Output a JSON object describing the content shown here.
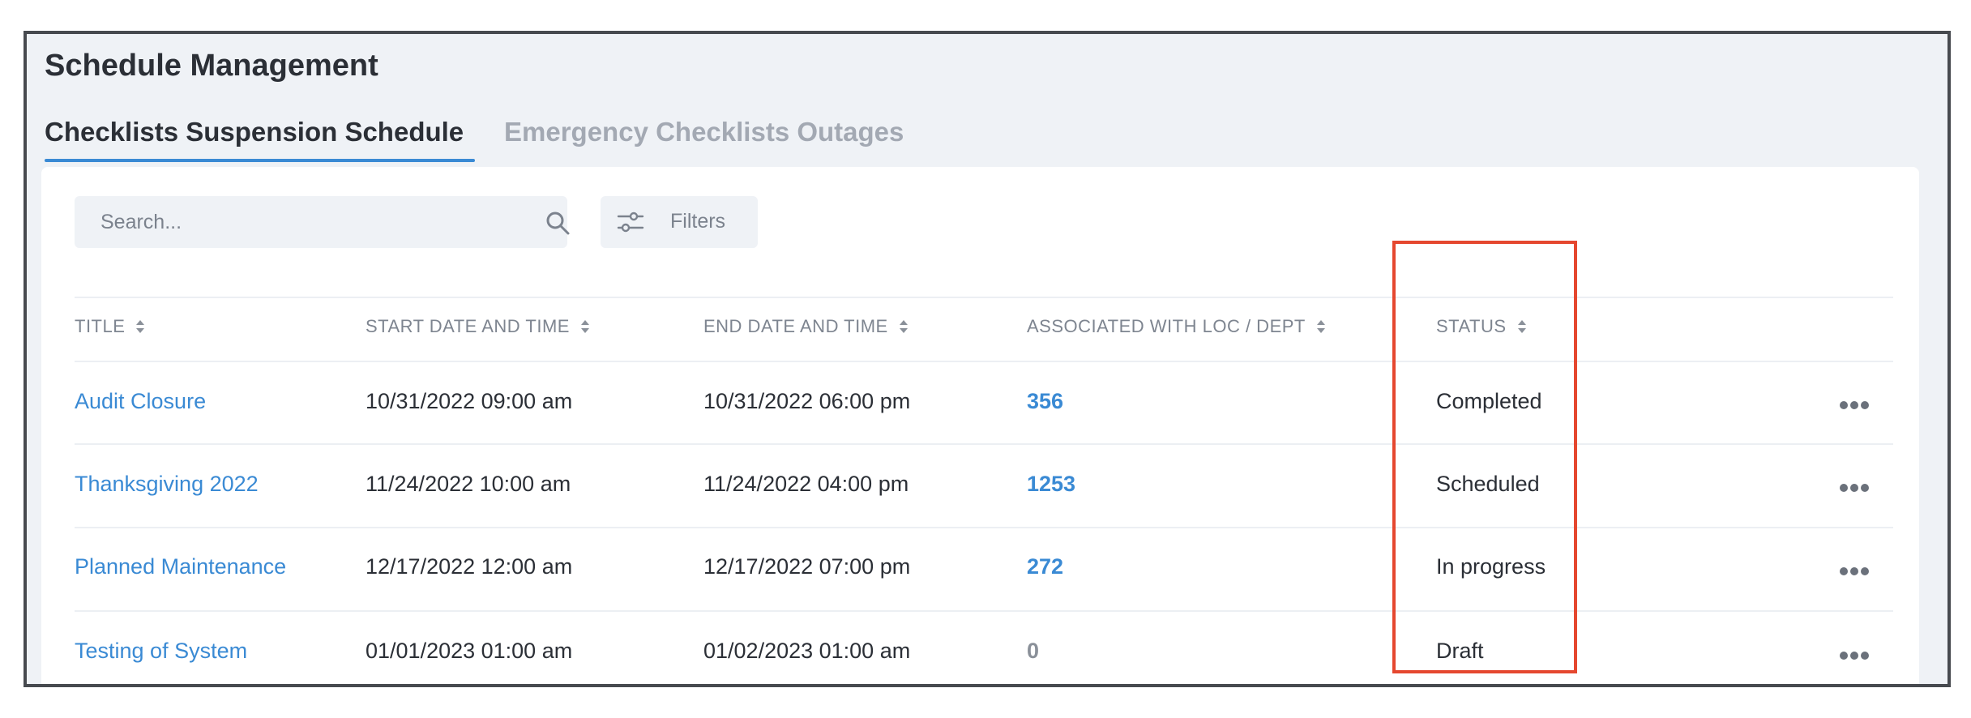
{
  "page_title": "Schedule Management",
  "tabs": [
    {
      "label": "Checklists Suspension Schedule",
      "active": true
    },
    {
      "label": "Emergency Checklists Outages",
      "active": false
    }
  ],
  "search": {
    "placeholder": "Search...",
    "value": "",
    "icon": "search-icon"
  },
  "filters": {
    "label": "Filters",
    "icon": "sliders-icon"
  },
  "table": {
    "columns": [
      "TITLE",
      "START DATE AND TIME",
      "END DATE AND TIME",
      "ASSOCIATED WITH LOC / DEPT",
      "STATUS"
    ],
    "rows": [
      {
        "title": "Audit Closure",
        "start": "10/31/2022  09:00 am",
        "end": "10/31/2022  06:00 pm",
        "associated": "356",
        "status": "Completed"
      },
      {
        "title": "Thanksgiving 2022",
        "start": "11/24/2022  10:00 am",
        "end": "11/24/2022  04:00 pm",
        "associated": "1253",
        "status": "Scheduled"
      },
      {
        "title": "Planned Maintenance",
        "start": "12/17/2022  12:00 am",
        "end": "12/17/2022  07:00 pm",
        "associated": "272",
        "status": "In progress"
      },
      {
        "title": "Testing of System",
        "start": "01/01/2023  01:00 am",
        "end": "01/02/2023  01:00 am",
        "associated": "0",
        "status": "Draft"
      }
    ]
  },
  "colors": {
    "accent": "#3a8ad4",
    "highlight": "#e5472f",
    "background": "#eff2f6",
    "frame": "#474a4f"
  }
}
